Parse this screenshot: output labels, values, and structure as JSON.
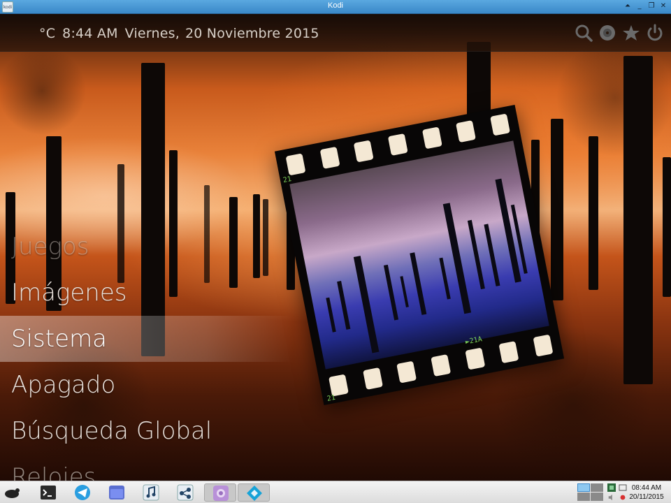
{
  "window": {
    "title": "Kodi",
    "app_icon_label": "kodi",
    "buttons": [
      "⏶",
      "_",
      "❐",
      "✕"
    ]
  },
  "header": {
    "temperature": "°C",
    "time": "8:44 AM",
    "day": "Viernes,",
    "date": "20 Noviembre 2015",
    "icons": [
      "search-icon",
      "disc-icon",
      "favourites-star-icon",
      "power-icon"
    ]
  },
  "menu": {
    "items": [
      {
        "label": "Juegos",
        "state": "faded"
      },
      {
        "label": "Imágenes",
        "state": "normal"
      },
      {
        "label": "Sistema",
        "state": "selected"
      },
      {
        "label": "Apagado",
        "state": "normal"
      },
      {
        "label": "Búsqueda Global",
        "state": "normal"
      },
      {
        "label": "Relojes",
        "state": "cut"
      }
    ]
  },
  "film": {
    "frame_top": "21",
    "frame_bottom_left": "21",
    "frame_bottom_right": "►21A"
  },
  "taskbar": {
    "apps": [
      "menu-icon",
      "terminal-icon",
      "telegram-icon",
      "files-icon",
      "music-icon",
      "network-icon",
      "screenshot-icon",
      "kodi-icon"
    ],
    "clock_time": "08:44 AM",
    "clock_date": "20/11/2015"
  },
  "colors": {
    "titlebar": "#3a88c8",
    "menu_text": "#e8e0da",
    "film_number": "#7ed35a"
  }
}
